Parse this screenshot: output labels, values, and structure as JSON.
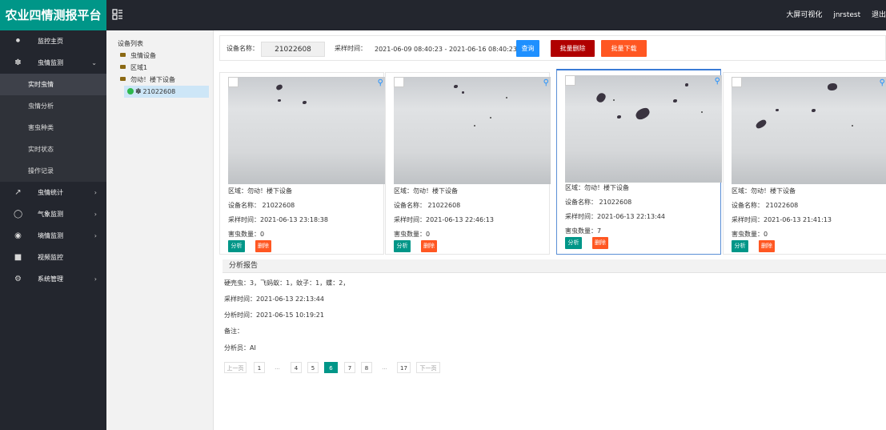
{
  "app": {
    "title": "农业四情测报平台"
  },
  "topbar": {
    "big_screen": "大屏可视化",
    "user": "jnrstest",
    "logout": "退出"
  },
  "sidebar": {
    "items": [
      {
        "label": "监控主页",
        "icon": "home-icon"
      },
      {
        "label": "虫情监测",
        "icon": "bug-icon"
      },
      {
        "label": "虫情统计",
        "icon": "chart-line-icon"
      },
      {
        "label": "气象监测",
        "icon": "weather-icon"
      },
      {
        "label": "墒情监测",
        "icon": "globe-icon"
      },
      {
        "label": "视频监控",
        "icon": "video-icon"
      },
      {
        "label": "系统管理",
        "icon": "gear-icon"
      }
    ],
    "sub_items": [
      "实时虫情",
      "虫情分析",
      "害虫种类",
      "实时状态",
      "操作记录"
    ]
  },
  "tree": {
    "title": "设备列表",
    "nodes": [
      "虫情设备",
      "区域1",
      "勿动！楼下设备",
      "21022608"
    ]
  },
  "filter": {
    "device_label": "设备名称：",
    "device_value": "21022608",
    "time_label": "采样时间：",
    "time_range": "2021-06-09 08:40:23 - 2021-06-16 08:40:23",
    "query": "查询",
    "batch_delete": "批量删除",
    "batch_download": "批量下载"
  },
  "cards": [
    {
      "area": "区域：勿动！楼下设备",
      "device": "设备名称： 21022608",
      "time": "采样时间：2021-06-13 23:18:38",
      "count": "害虫数量：0",
      "analyze": "分析",
      "delete": "删除"
    },
    {
      "area": "区域：勿动！楼下设备",
      "device": "设备名称： 21022608",
      "time": "采样时间：2021-06-13 22:46:13",
      "count": "害虫数量：0",
      "analyze": "分析",
      "delete": "删除"
    },
    {
      "area": "区域：勿动！楼下设备",
      "device": "设备名称： 21022608",
      "time": "采样时间：2021-06-13 22:13:44",
      "count": "害虫数量：7",
      "analyze": "分析",
      "delete": "删除"
    },
    {
      "area": "区域：勿动！楼下设备",
      "device": "设备名称： 21022608",
      "time": "采样时间：2021-06-13 21:41:13",
      "count": "害虫数量：0",
      "analyze": "分析",
      "delete": "删除"
    }
  ],
  "report": {
    "title": "分析报告",
    "result": "硬壳虫：3，飞蚂蚁：1，蚊子：1，蝶：2，",
    "sample_time": "采样时间：2021-06-13 22:13:44",
    "analysis_time": "分析时间：2021-06-15 10:19:21",
    "note": "备注：",
    "analyst": "分析员：AI"
  },
  "pagination": {
    "prev": "上一页",
    "pages": [
      "1",
      "...",
      "4",
      "5",
      "6",
      "7",
      "8",
      "...",
      "17"
    ],
    "current": "6",
    "next": "下一页"
  }
}
